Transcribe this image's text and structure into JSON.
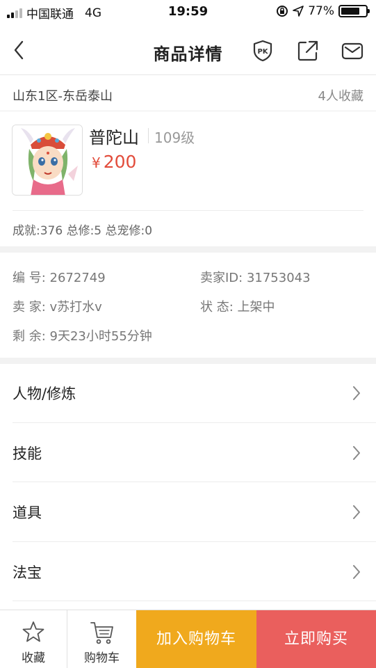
{
  "status_bar": {
    "carrier": "中国联通",
    "network": "4G",
    "time": "19:59",
    "battery": "77%",
    "battery_level": 0.77
  },
  "nav": {
    "title": "商品详情",
    "back_icon": "chevron-left-icon",
    "pk_icon": "pk-shield-icon",
    "share_icon": "share-icon",
    "message_icon": "mail-icon"
  },
  "server": {
    "name": "山东1区-东岳泰山",
    "favorites": "4人收藏"
  },
  "product": {
    "name": "普陀山",
    "level": "109级",
    "currency": "¥",
    "price": "200",
    "stats": "成就:376 总修:5 总宠修:0"
  },
  "info": {
    "id": "编  号: 2672749",
    "seller_id": "卖家ID: 31753043",
    "seller": "卖  家: v苏打水v",
    "status": "状  态: 上架中",
    "remaining": "剩  余: 9天23小时55分钟"
  },
  "menu": [
    {
      "label": "人物/修炼"
    },
    {
      "label": "技能"
    },
    {
      "label": "道具"
    },
    {
      "label": "法宝"
    }
  ],
  "bottom_bar": {
    "favorite_label": "收藏",
    "cart_label": "购物车",
    "add_cart_label": "加入购物车",
    "buy_now_label": "立即购买"
  },
  "colors": {
    "price": "#e24c3b",
    "add_cart_bg": "#f0a91d",
    "buy_now_bg": "#ea5f5d"
  }
}
